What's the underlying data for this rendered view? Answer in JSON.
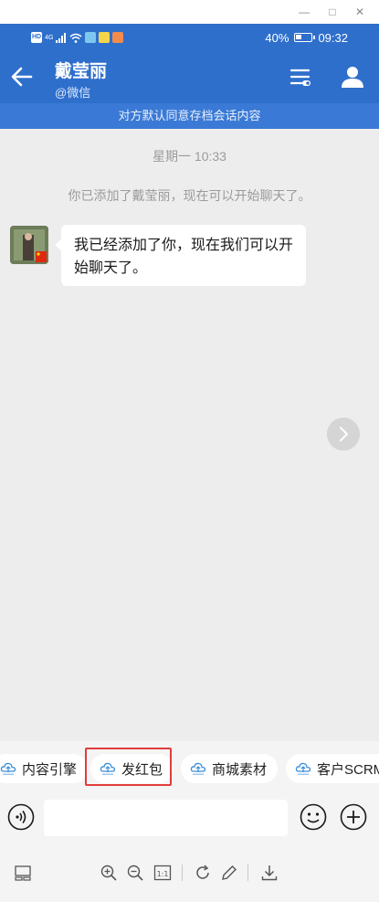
{
  "status_bar": {
    "left_badges": [
      "HD",
      "4G"
    ],
    "battery_percent": "40%",
    "battery_level": 0.4,
    "time": "09:32"
  },
  "header": {
    "title": "戴莹丽",
    "subtitle": "@微信"
  },
  "notice": "对方默认同意存档会话内容",
  "chat": {
    "time_divider": "星期一  10:33",
    "system_message": "你已添加了戴莹丽，现在可以开始聊天了。",
    "messages": [
      {
        "from": "contact",
        "text": "我已经添加了你，现在我们可以开始聊天了。"
      }
    ]
  },
  "quick_actions": [
    {
      "label": "内容引擎",
      "icon": "cloud-logo-icon"
    },
    {
      "label": "发红包",
      "icon": "cloud-logo-icon",
      "highlighted": true
    },
    {
      "label": "商城素材",
      "icon": "cloud-logo-icon"
    },
    {
      "label": "客户SCRM",
      "icon": "cloud-logo-icon"
    }
  ],
  "input": {
    "placeholder": ""
  },
  "colors": {
    "header_blue": "#2f6fcc",
    "notice_blue": "#3a7ad6",
    "highlight_red": "#e23c3c",
    "chat_background": "#ededed"
  }
}
